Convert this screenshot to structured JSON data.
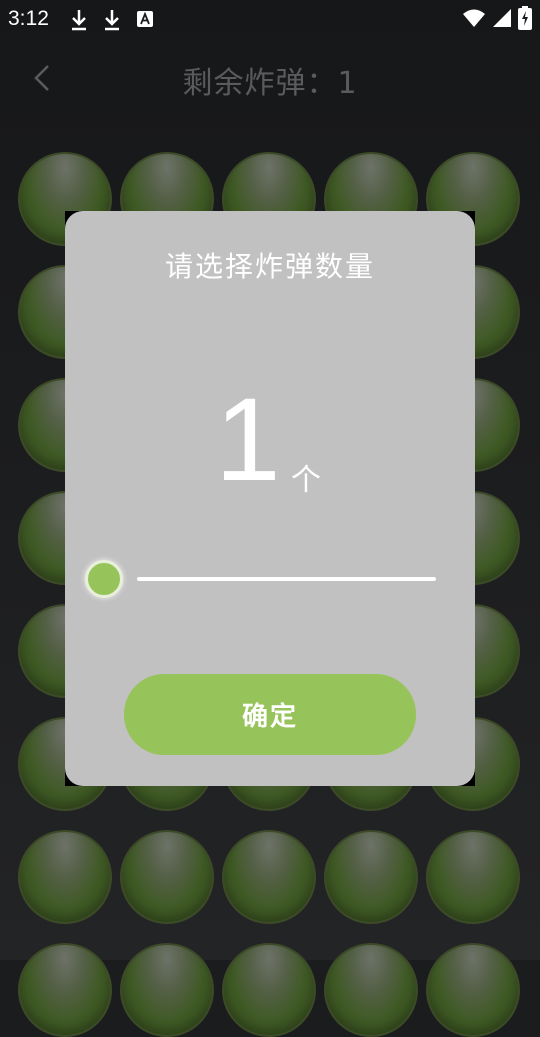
{
  "status_bar": {
    "time": "3:12",
    "left_icons": [
      "download-icon",
      "download-icon",
      "text-a-icon"
    ],
    "right_icons": [
      "wifi-icon",
      "cellular-icon",
      "battery-charging-icon"
    ]
  },
  "header": {
    "back_icon": "chevron-left-icon",
    "title": "剩余炸弹：1"
  },
  "grid": {
    "rows": 8,
    "columns": 5,
    "ball_color": "#3f5a24"
  },
  "dialog": {
    "title": "请选择炸弹数量",
    "count_value": "1",
    "count_unit": "个",
    "slider": {
      "value": 1,
      "fraction": 0.0
    },
    "confirm_label": "确定",
    "accent_color": "#96c35a",
    "background_color": "#c1c1c1"
  }
}
